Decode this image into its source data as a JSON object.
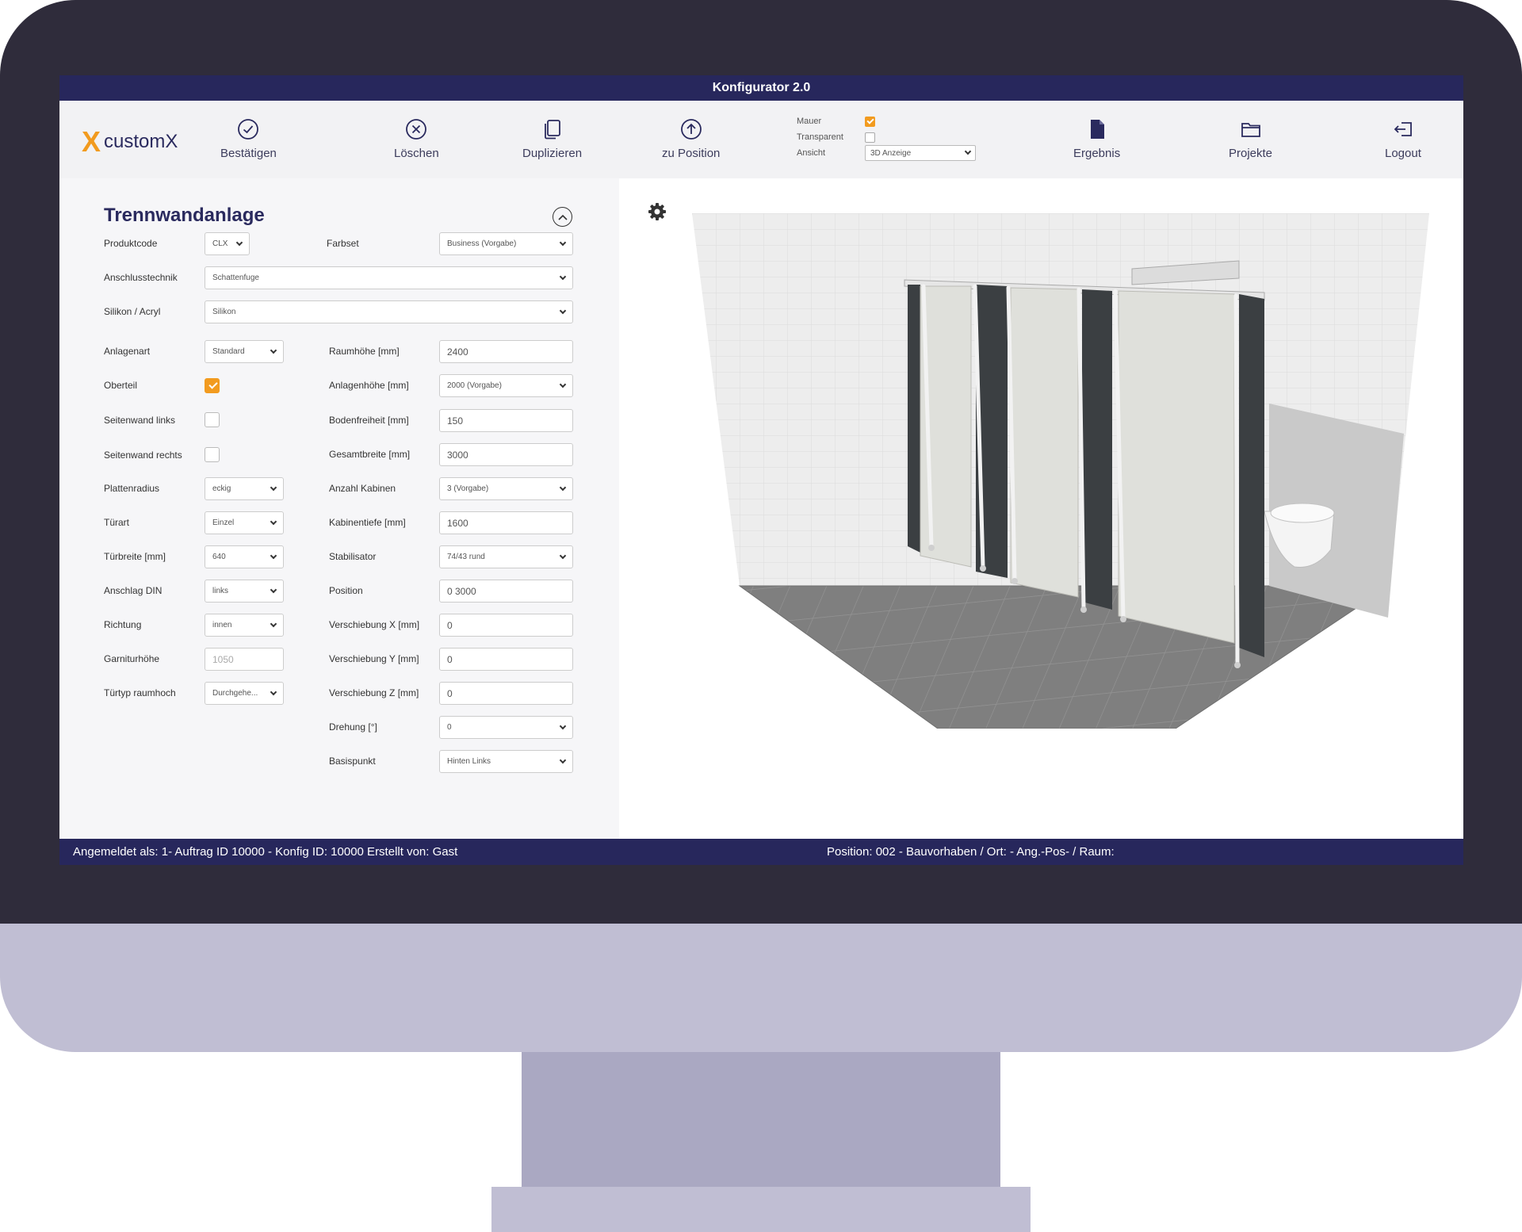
{
  "window": {
    "title": "Konfigurator 2.0"
  },
  "brand": {
    "mark": "X",
    "name": "customX",
    "accent": "#f29b1f",
    "navy": "#27275c"
  },
  "toolbar": {
    "confirm": {
      "label": "Bestätigen",
      "icon": "check-circle-icon"
    },
    "delete": {
      "label": "Löschen",
      "icon": "x-circle-icon"
    },
    "duplicate": {
      "label": "Duplizieren",
      "icon": "copy-icon"
    },
    "to_position": {
      "label": "zu Position",
      "icon": "arrow-up-circle-icon"
    },
    "result": {
      "label": "Ergebnis",
      "icon": "document-icon"
    },
    "projects": {
      "label": "Projekte",
      "icon": "folder-icon"
    },
    "logout": {
      "label": "Logout",
      "icon": "logout-icon"
    }
  },
  "view_options": {
    "wall": {
      "label": "Mauer",
      "checked": true
    },
    "transparent": {
      "label": "Transparent",
      "checked": false
    },
    "view": {
      "label": "Ansicht",
      "value": "3D Anzeige"
    }
  },
  "panel": {
    "title": "Trennwandanlage",
    "fields": {
      "produktcode": {
        "label": "Produktcode",
        "value": "CLX"
      },
      "farbset": {
        "label": "Farbset",
        "value": "Business (Vorgabe)"
      },
      "anschlusstechnik": {
        "label": "Anschlusstechnik",
        "value": "Schattenfuge"
      },
      "silikon": {
        "label": "Silikon / Acryl",
        "value": "Silikon"
      },
      "anlagenart": {
        "label": "Anlagenart",
        "value": "Standard"
      },
      "oberteil": {
        "label": "Oberteil",
        "checked": true
      },
      "seitenwand_links": {
        "label": "Seitenwand links",
        "checked": false
      },
      "seitenwand_rechts": {
        "label": "Seitenwand rechts",
        "checked": false
      },
      "plattenradius": {
        "label": "Plattenradius",
        "value": "eckig"
      },
      "tuerart": {
        "label": "Türart",
        "value": "Einzel"
      },
      "tuerbreite": {
        "label": "Türbreite [mm]",
        "value": "640"
      },
      "anschlag": {
        "label": "Anschlag DIN",
        "value": "links"
      },
      "richtung": {
        "label": "Richtung",
        "value": "innen"
      },
      "garniturhoehe": {
        "label": "Garniturhöhe",
        "value": "1050"
      },
      "tuertyp": {
        "label": "Türtyp raumhoch",
        "value": "Durchgehe..."
      },
      "raumhoehe": {
        "label": "Raumhöhe [mm]",
        "value": "2400"
      },
      "anlagenhoehe": {
        "label": "Anlagenhöhe [mm]",
        "value": "2000 (Vorgabe)"
      },
      "bodenfreiheit": {
        "label": "Bodenfreiheit [mm]",
        "value": "150"
      },
      "gesamtbreite": {
        "label": "Gesamtbreite [mm]",
        "value": "3000"
      },
      "anzahl_kabinen": {
        "label": "Anzahl Kabinen",
        "value": "3 (Vorgabe)"
      },
      "kabinentiefe": {
        "label": "Kabinentiefe [mm]",
        "value": "1600"
      },
      "stabilisator": {
        "label": "Stabilisator",
        "value": "74/43 rund"
      },
      "position": {
        "label": "Position",
        "value": "0 3000"
      },
      "verschiebung_x": {
        "label": "Verschiebung X [mm]",
        "value": "0"
      },
      "verschiebung_y": {
        "label": "Verschiebung Y [mm]",
        "value": "0"
      },
      "verschiebung_z": {
        "label": "Verschiebung Z [mm]",
        "value": "0"
      },
      "drehung": {
        "label": "Drehung [°]",
        "value": "0"
      },
      "basispunkt": {
        "label": "Basispunkt",
        "value": "Hinten Links"
      }
    }
  },
  "status": {
    "left": "Angemeldet als: 1- Auftrag ID 10000 - Konfig ID: 10000 Erstellt von: Gast",
    "right": "Position: 002 - Bauvorhaben / Ort: - Ang.-Pos- / Raum:"
  }
}
